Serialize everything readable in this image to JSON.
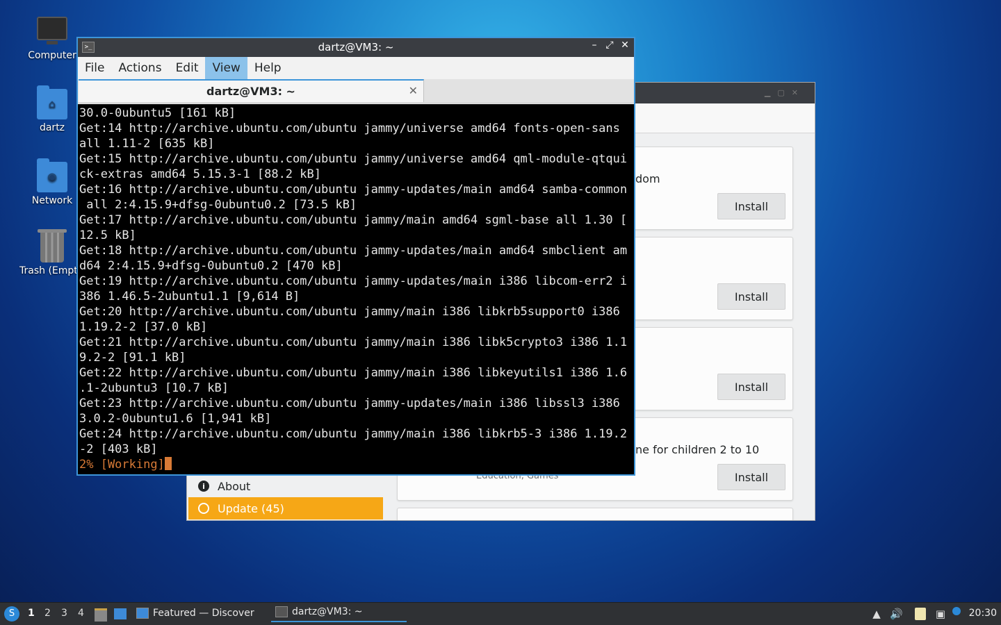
{
  "desktop": {
    "icons": [
      {
        "label": "Computer"
      },
      {
        "label": "dartz"
      },
      {
        "label": "Network"
      },
      {
        "label": "Trash (Empt"
      }
    ]
  },
  "discover": {
    "sidebar": {
      "about": "About",
      "update": "Update (45)"
    },
    "cards": [
      {
        "desc": "dom",
        "install": "Install"
      },
      {
        "desc": "",
        "install": "Install"
      },
      {
        "desc": "",
        "install": "Install"
      },
      {
        "desc": "ne for children 2 to 10",
        "install": "Install",
        "meta": "Education, Games"
      }
    ]
  },
  "terminal": {
    "window_title": "dartz@VM3: ~",
    "menu": [
      "File",
      "Actions",
      "Edit",
      "View",
      "Help"
    ],
    "active_menu": "View",
    "tab_title": "dartz@VM3: ~",
    "lines": [
      "30.0-0ubuntu5 [161 kB]",
      "Get:14 http://archive.ubuntu.com/ubuntu jammy/universe amd64 fonts-open-sans",
      "all 1.11-2 [635 kB]",
      "Get:15 http://archive.ubuntu.com/ubuntu jammy/universe amd64 qml-module-qtqui",
      "ck-extras amd64 5.15.3-1 [88.2 kB]",
      "Get:16 http://archive.ubuntu.com/ubuntu jammy-updates/main amd64 samba-common",
      " all 2:4.15.9+dfsg-0ubuntu0.2 [73.5 kB]",
      "Get:17 http://archive.ubuntu.com/ubuntu jammy/main amd64 sgml-base all 1.30 [",
      "12.5 kB]",
      "Get:18 http://archive.ubuntu.com/ubuntu jammy-updates/main amd64 smbclient am",
      "d64 2:4.15.9+dfsg-0ubuntu0.2 [470 kB]",
      "Get:19 http://archive.ubuntu.com/ubuntu jammy-updates/main i386 libcom-err2 i",
      "386 1.46.5-2ubuntu1.1 [9,614 B]",
      "Get:20 http://archive.ubuntu.com/ubuntu jammy/main i386 libkrb5support0 i386",
      "1.19.2-2 [37.0 kB]",
      "Get:21 http://archive.ubuntu.com/ubuntu jammy/main i386 libk5crypto3 i386 1.1",
      "9.2-2 [91.1 kB]",
      "Get:22 http://archive.ubuntu.com/ubuntu jammy/main i386 libkeyutils1 i386 1.6",
      ".1-2ubuntu3 [10.7 kB]",
      "Get:23 http://archive.ubuntu.com/ubuntu jammy-updates/main i386 libssl3 i386",
      "3.0.2-0ubuntu1.6 [1,941 kB]",
      "Get:24 http://archive.ubuntu.com/ubuntu jammy/main i386 libkrb5-3 i386 1.19.2",
      "-2 [403 kB]"
    ],
    "progress_line": "2% [Working]"
  },
  "taskbar": {
    "workspaces": [
      "1",
      "2",
      "3",
      "4"
    ],
    "active_workspace": "1",
    "tasks": [
      {
        "label": "Featured — Discover"
      },
      {
        "label": "dartz@VM3: ~"
      }
    ],
    "clock": "20:30"
  }
}
